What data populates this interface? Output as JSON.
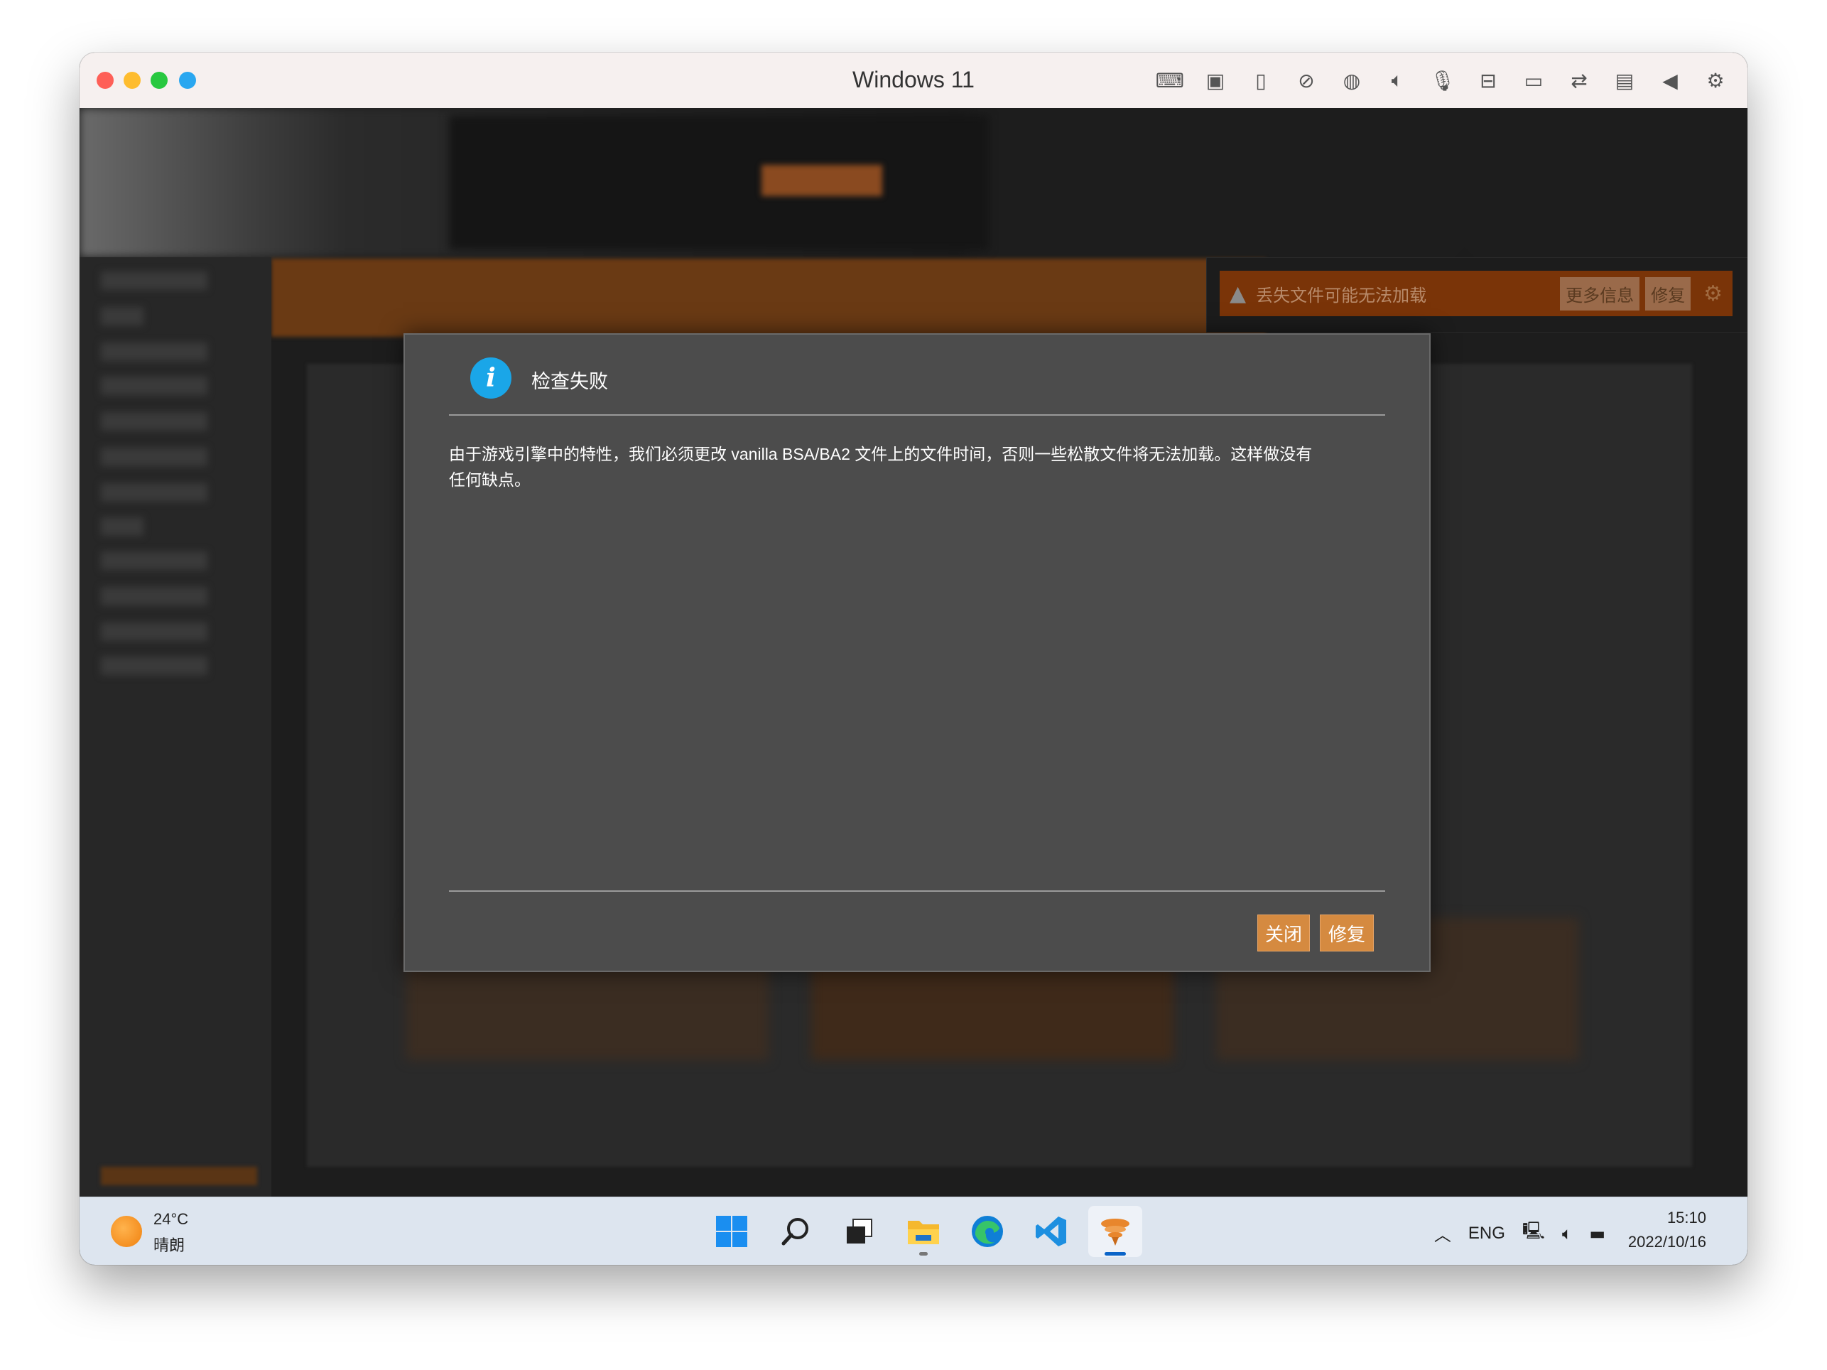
{
  "window": {
    "title": "Windows 11",
    "toolbar_icons": [
      "keyboard-icon",
      "cpu-icon",
      "usb-icon",
      "camera-off-icon",
      "globe-icon",
      "speaker-icon",
      "microphone-icon",
      "drive-icon",
      "video-icon",
      "folder-share-icon",
      "terminal-icon",
      "triangle-left-icon",
      "gear-icon"
    ]
  },
  "notification": {
    "text": "丢失文件可能无法加载",
    "more_info_label": "更多信息",
    "fix_label": "修复"
  },
  "dialog": {
    "title": "检查失败",
    "body_line1": "由于游戏引擎中的特性，我们必须更改 vanilla BSA/BA2 文件上的文件时间，否则一些松散文件将无法加载。这样做没有",
    "body_line2": "任何缺点。",
    "close_label": "关闭",
    "fix_label": "修复"
  },
  "taskbar": {
    "temperature": "24°C",
    "weather": "晴朗",
    "language": "ENG",
    "time": "15:10",
    "date": "2022/10/16"
  },
  "colors": {
    "accent": "#d58a40",
    "info_blue": "#1aa6e8",
    "dialog_bg": "#4c4c4c",
    "warning_bar": "#7a3408"
  }
}
